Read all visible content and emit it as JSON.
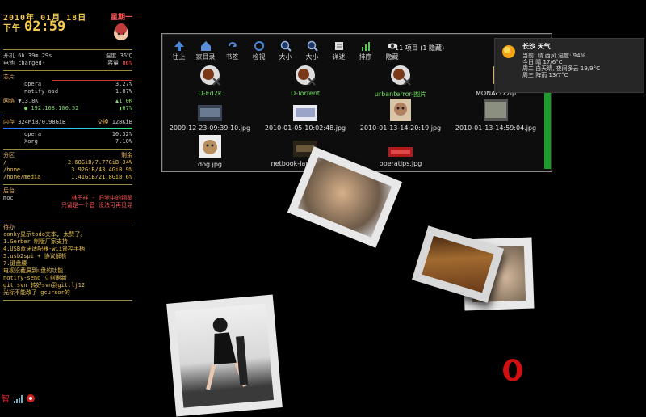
{
  "conky": {
    "date": "2010年 01月 18日",
    "weekday": "星期一",
    "ampm": "下午",
    "time": "02:59",
    "uptime_label": "开机",
    "uptime": "6h 39m 29s",
    "temp_label": "温度",
    "temp": "36℃",
    "battery_label": "电池",
    "battery": "charged-",
    "capacity_label": "容量",
    "capacity": "86%",
    "cpu_label": "芯片",
    "cpu_procs": [
      {
        "name": "opera",
        "value": "3.27%"
      },
      {
        "name": "notify-osd",
        "value": "1.87%"
      }
    ],
    "net_label": "网络",
    "net_down": "▼13.8K",
    "net_up": "▲1.0K",
    "ip": "● 192.168.100.52",
    "wifi": "▮67%",
    "mem_label": "内存",
    "mem": "324MiB/0.98GiB",
    "swap_label": "交换",
    "swap": "128KiB",
    "mem_procs": [
      {
        "name": "opera",
        "value": "10.32%"
      },
      {
        "name": "Xorg",
        "value": "7.10%"
      }
    ],
    "part_label": "分区",
    "free_label": "剩余",
    "partitions": [
      {
        "mount": "/",
        "value": "2.68GiB/7.77GiB 34%"
      },
      {
        "mount": "/home",
        "value": "3.92GiB/43.4GiB 9%"
      },
      {
        "mount": "/home/media",
        "value": "1.41GiB/21.8GiB 6%"
      }
    ],
    "bg_label": "后台",
    "moc": "moc",
    "song1": "林子祥 - 旧梦中的钢琴",
    "song2": "只留是一个音 没法可再觅寻",
    "todo_label": "待办",
    "todos": [
      "conky显示todo文本, 太赞了。",
      "1.Gerber 制版厂家支持",
      "4.USB蓝牙适配器-wii遥控手柄",
      "5.usb2spi + 协议解析",
      "7.键盘腰",
      "电视没截屏到u盘的功能",
      "notify-send 立刻刷新",
      "git svn 转好svn到git.lj12",
      "光标不能改了 gcursor的"
    ]
  },
  "toolbar": [
    {
      "label": "往上",
      "icon": "up-arrow-icon"
    },
    {
      "label": "家目录",
      "icon": "home-icon"
    },
    {
      "label": "书签",
      "icon": "bookmark-icon"
    },
    {
      "label": "检视",
      "icon": "reload-icon"
    },
    {
      "label": "大小",
      "icon": "zoom-in-icon"
    },
    {
      "label": "大小",
      "icon": "zoom-out-icon"
    },
    {
      "label": "详述",
      "icon": "details-icon"
    },
    {
      "label": "排序",
      "icon": "sort-icon"
    },
    {
      "label": "隐藏",
      "icon": "eye-icon"
    }
  ],
  "status": "11 项目 (1 隐藏)",
  "files": [
    {
      "name": "D-Ed2k",
      "kind": "app"
    },
    {
      "name": "D-Torrent",
      "kind": "app"
    },
    {
      "name": "urbanterror-图片",
      "kind": "app"
    },
    {
      "name": "MONACO.zip",
      "kind": "zip"
    },
    {
      "name": "2009-12-23-09:39:10.jpg",
      "kind": "img"
    },
    {
      "name": "2010-01-05-10:02:48.jpg",
      "kind": "img"
    },
    {
      "name": "2010-01-13-14:20:19.jpg",
      "kind": "img"
    },
    {
      "name": "2010-01-13-14:59:04.jpg",
      "kind": "img"
    },
    {
      "name": "dog.jpg",
      "kind": "img"
    },
    {
      "name": "netbook-lanucher.jpg",
      "kind": "img"
    },
    {
      "name": "operatips.jpg",
      "kind": "img"
    }
  ],
  "weather": {
    "title": "长沙 天气",
    "lines": [
      "当前: 晴 西风 湿度: 94%",
      "今日 晴 17/6°C",
      "周二 白天晴, 夜间多云 19/9°C",
      "周三 阵雨 13/7°C"
    ]
  },
  "colors": {
    "accent_green": "#6fe05e",
    "clock": "#f2c94c",
    "alert_red": "#ff5555"
  }
}
